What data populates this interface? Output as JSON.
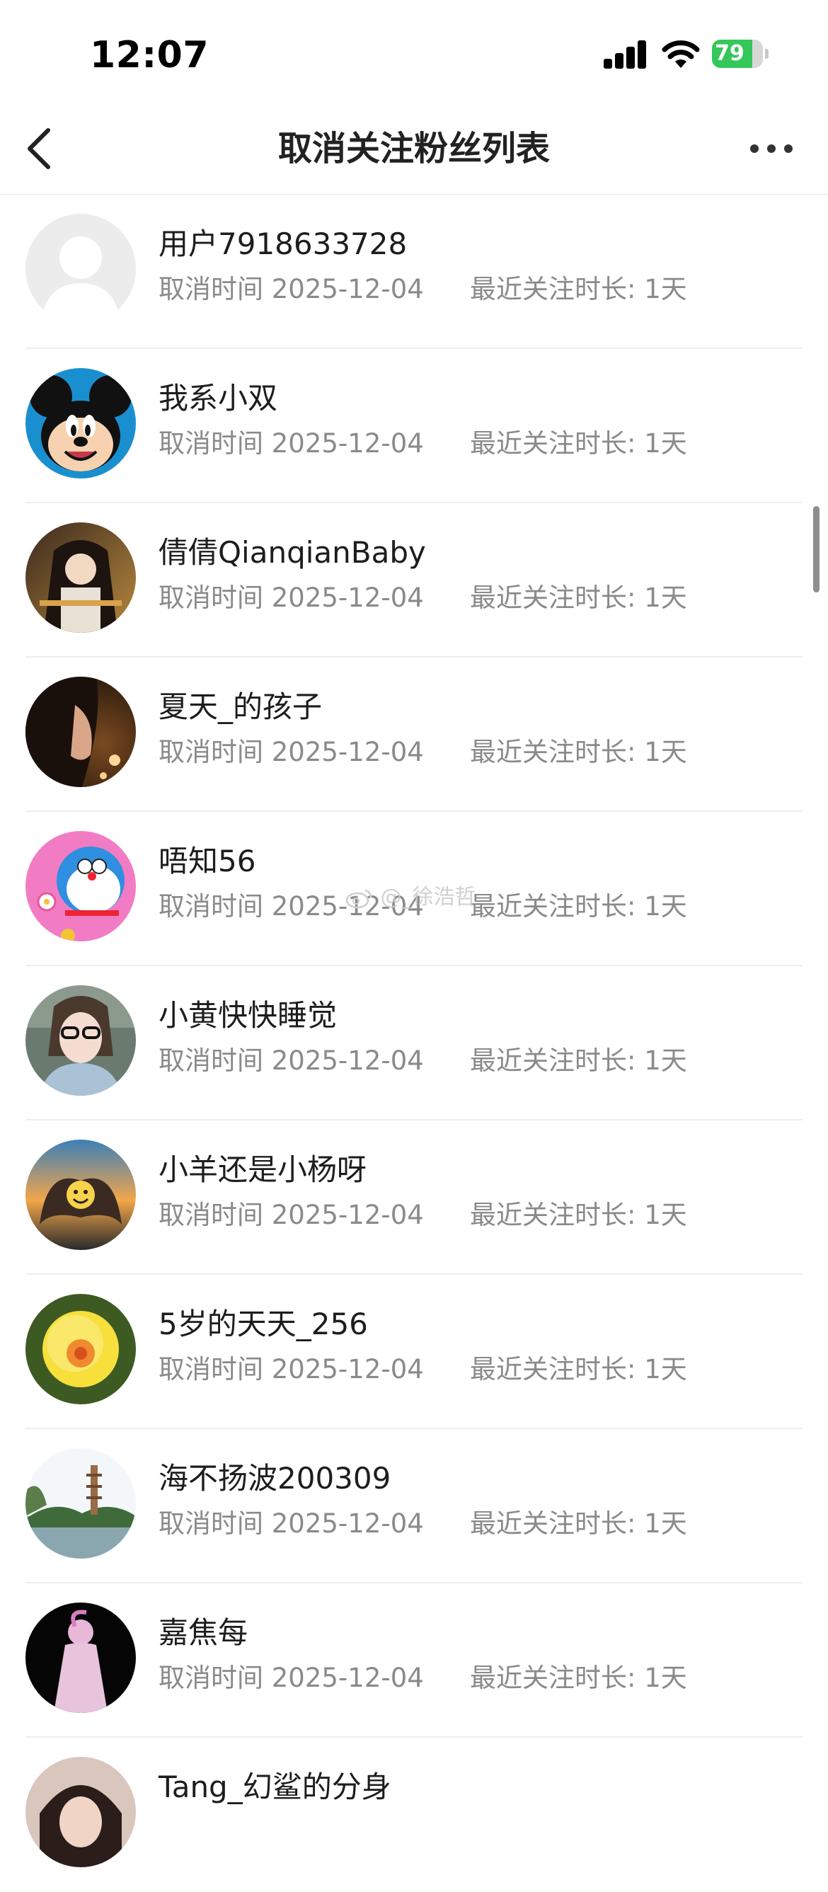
{
  "status_bar": {
    "time": "12:07",
    "battery": "79"
  },
  "header": {
    "title": "取消关注粉丝列表"
  },
  "list": {
    "items": [
      {
        "name": "用户7918633728",
        "cancel_label": "取消时间 2025-12-04",
        "duration_label": "最近关注时长: 1天"
      },
      {
        "name": "我系小双",
        "cancel_label": "取消时间 2025-12-04",
        "duration_label": "最近关注时长: 1天"
      },
      {
        "name": "倩倩QianqianBaby",
        "cancel_label": "取消时间 2025-12-04",
        "duration_label": "最近关注时长: 1天"
      },
      {
        "name": "夏天_的孩子",
        "cancel_label": "取消时间 2025-12-04",
        "duration_label": "最近关注时长: 1天"
      },
      {
        "name": "唔知56",
        "cancel_label": "取消时间 2025-12-04",
        "duration_label": "最近关注时长: 1天"
      },
      {
        "name": "小黄快快睡觉",
        "cancel_label": "取消时间 2025-12-04",
        "duration_label": "最近关注时长: 1天"
      },
      {
        "name": "小羊还是小杨呀",
        "cancel_label": "取消时间 2025-12-04",
        "duration_label": "最近关注时长: 1天"
      },
      {
        "name": "5岁的天天_256",
        "cancel_label": "取消时间 2025-12-04",
        "duration_label": "最近关注时长: 1天"
      },
      {
        "name": "海不扬波200309",
        "cancel_label": "取消时间 2025-12-04",
        "duration_label": "最近关注时长: 1天"
      },
      {
        "name": "嘉焦每",
        "cancel_label": "取消时间 2025-12-04",
        "duration_label": "最近关注时长: 1天"
      },
      {
        "name": "Tang_幻鲨的分身",
        "cancel_label": "",
        "duration_label": ""
      }
    ]
  },
  "watermark": {
    "text": "@_徐浩哲"
  }
}
